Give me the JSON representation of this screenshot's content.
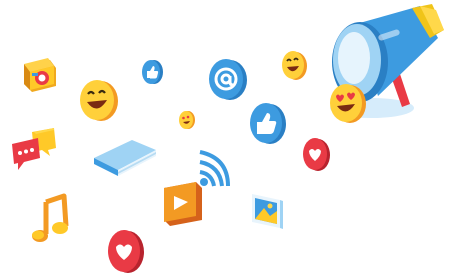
{
  "illustration": {
    "icons": [
      "camera-icon",
      "laughing-emoji-icon",
      "thumbs-up-coin-icon",
      "at-sign-icon",
      "smiling-emoji-icon",
      "megaphone-icon",
      "heart-eyes-emoji-icon",
      "chat-bubbles-icon",
      "book-icon",
      "small-emoji-icon",
      "thumbs-up-badge-icon",
      "wifi-icon",
      "heart-coin-icon",
      "music-note-icon",
      "video-play-icon",
      "picture-icon",
      "heart-coin-large-icon"
    ],
    "colors": {
      "blue": "#3d9be0",
      "light_blue": "#9fd3f4",
      "yellow": "#ffc928",
      "orange": "#f39a23",
      "red": "#e93a45",
      "white": "#ffffff"
    }
  }
}
